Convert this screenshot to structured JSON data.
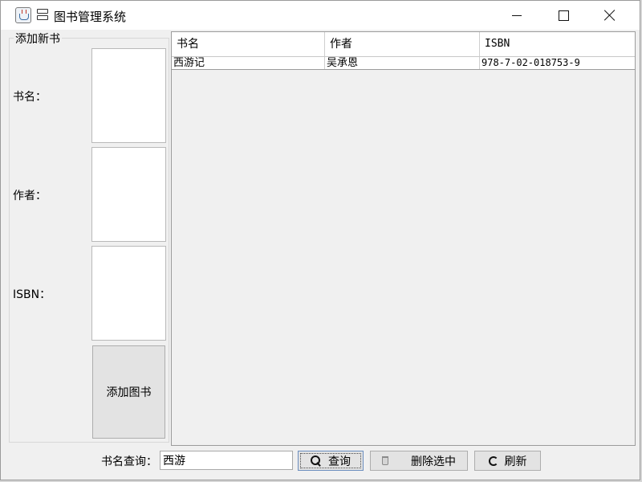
{
  "window": {
    "title": "图书管理系统"
  },
  "form": {
    "legend": "添加新书",
    "fields": [
      {
        "label": "书名："
      },
      {
        "label": "作者："
      },
      {
        "label": "ISBN："
      }
    ],
    "add_button": "添加图书"
  },
  "table": {
    "columns": [
      "书名",
      "作者",
      "ISBN"
    ],
    "rows": [
      [
        "西游记",
        "吴承恩",
        "978-7-02-018753-9"
      ]
    ]
  },
  "search": {
    "label": "书名查询：",
    "value": "西游"
  },
  "buttons": {
    "query": "查询",
    "delete": "删除选中",
    "refresh": "刷新"
  }
}
